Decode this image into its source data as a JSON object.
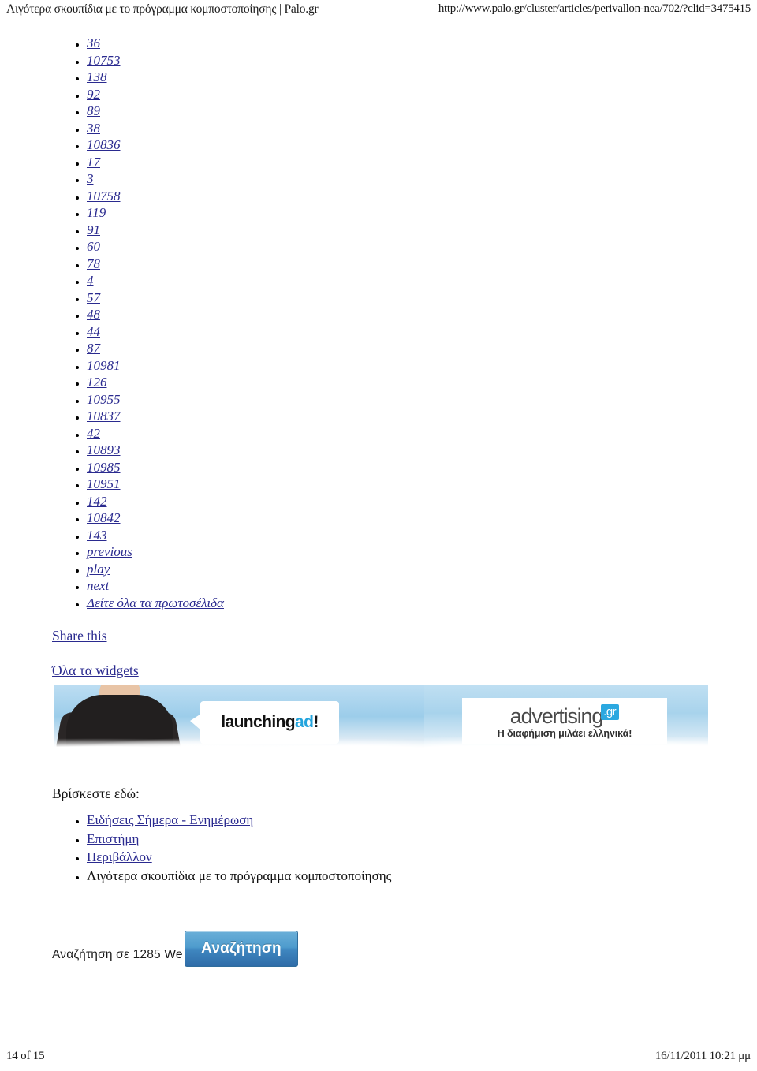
{
  "print_header": {
    "title": "Λιγότερα σκουπίδια με το πρόγραμμα κομποστοποίησης | Palo.gr",
    "url": "http://www.palo.gr/cluster/articles/perivallon-nea/702/?clid=3475415"
  },
  "numbers_list": [
    "36",
    "10753",
    "138",
    "92",
    "89",
    "38",
    "10836",
    "17",
    "3",
    "10758",
    "119",
    "91",
    "60",
    "78",
    "4",
    "57",
    "48",
    "44",
    "87",
    "10981",
    "126",
    "10955",
    "10837",
    "42",
    "10893",
    "10985",
    "10951",
    "142",
    "10842",
    "143"
  ],
  "controls": [
    "previous",
    "play",
    "next"
  ],
  "see_all": "Δείτε όλα τα πρωτοσέλιδα",
  "share_this": "Share this",
  "all_widgets": "Όλα τα widgets",
  "ad_banner": {
    "left_ad": {
      "text_main": "launching ",
      "text_highlight": "ad",
      "text_tail": "!",
      "highlight_color": "#22a4dd"
    },
    "right_ad": {
      "brand": "advertising",
      "brand_tld": ".gr",
      "tagline": "Η διαφήμιση μιλάει ελληνικά!",
      "accent_color": "#2ba8e0"
    }
  },
  "breadcrumb": {
    "label": "Βρίσκεστε εδώ:",
    "items": [
      {
        "label": "Ειδήσεις Σήμερα - Ενημέρωση",
        "current": false
      },
      {
        "label": "Επιστήμη",
        "current": false
      },
      {
        "label": "Περιβάλλον",
        "current": false
      },
      {
        "label": "Λιγότερα σκουπίδια με το πρόγραμμα κομποστοποίησης",
        "current": true
      }
    ]
  },
  "search": {
    "caption": "Αναζήτηση σε 1285 We",
    "button_label": "Αναζήτηση",
    "button_color": "#3f87c0"
  },
  "print_footer": {
    "page": "14 of 15",
    "timestamp": "16/11/2011 10:21 μμ"
  },
  "colors": {
    "link": "#2a2a8f",
    "text": "#111111",
    "background": "#ffffff"
  }
}
